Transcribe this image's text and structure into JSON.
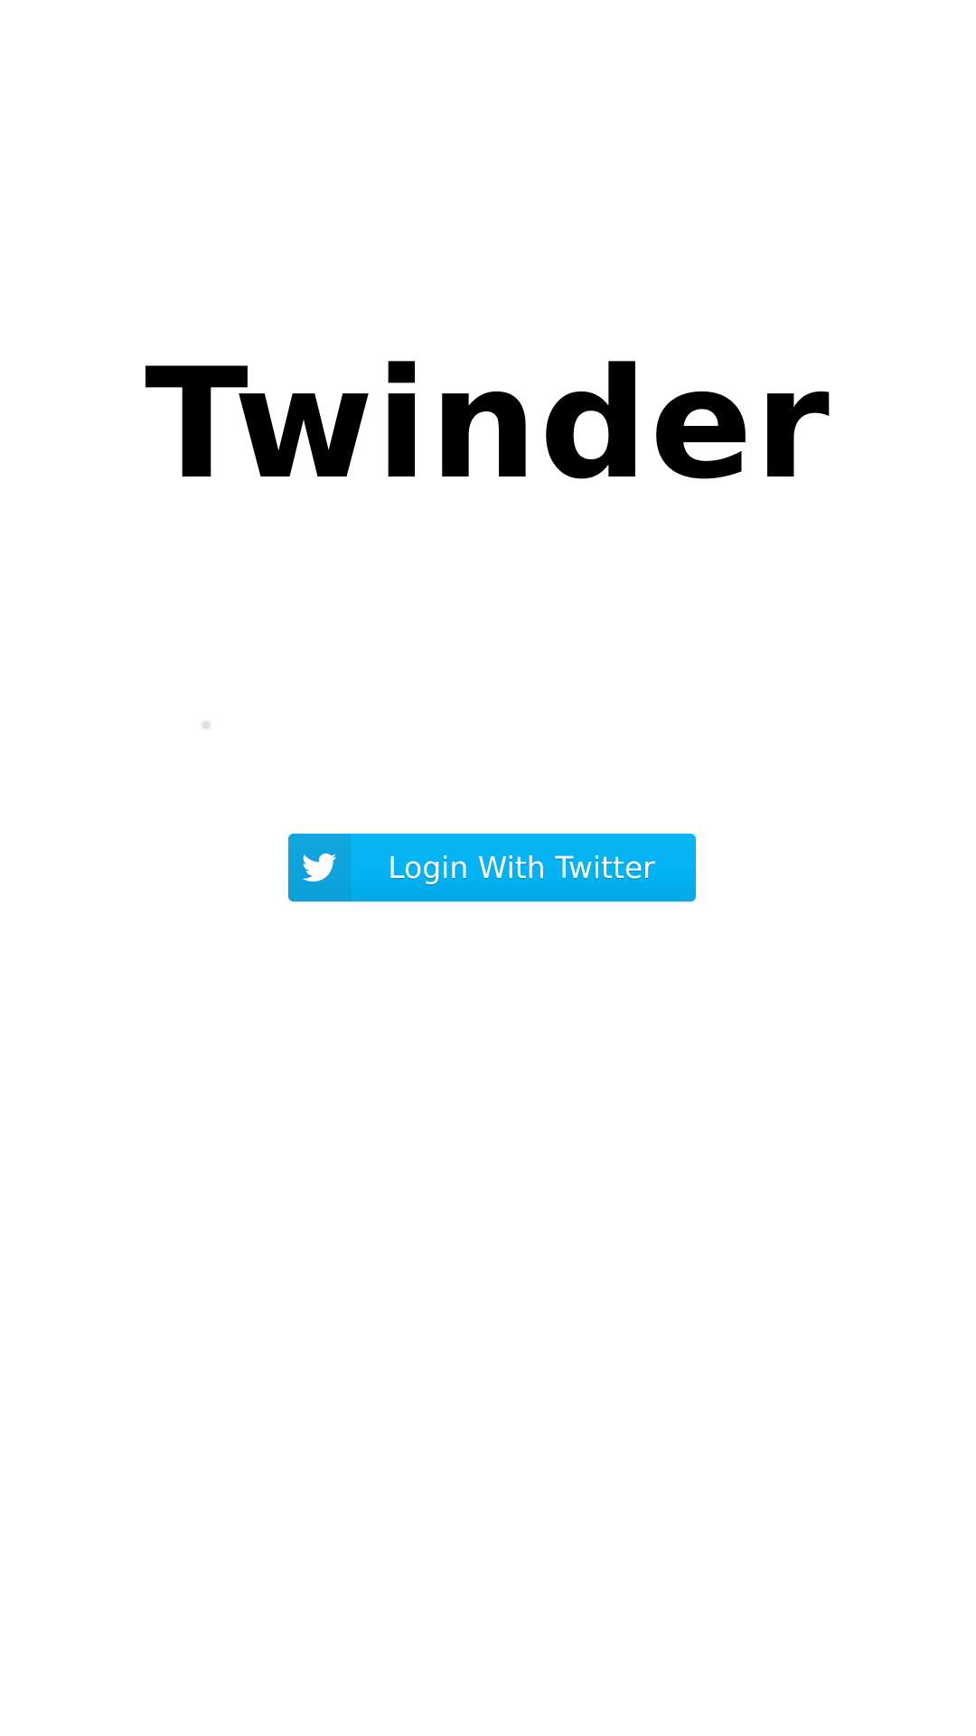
{
  "app": {
    "title": "Twinder"
  },
  "login": {
    "button_label": "Login With Twitter",
    "icon": "twitter-bird-icon",
    "accent_color": "#03b3f2"
  }
}
